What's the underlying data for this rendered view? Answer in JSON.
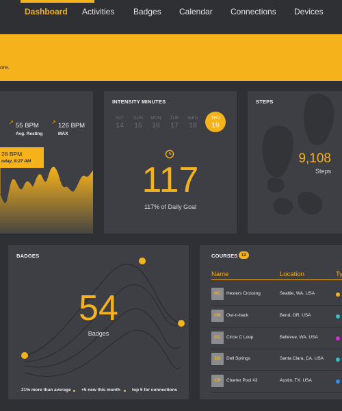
{
  "nav": {
    "items": [
      {
        "label": "Dashboard"
      },
      {
        "label": "Activities"
      },
      {
        "label": "Badges"
      },
      {
        "label": "Calendar"
      },
      {
        "label": "Connections"
      },
      {
        "label": "Devices"
      }
    ]
  },
  "banner": {
    "text": "ore."
  },
  "heart": {
    "resting_value": "55 BPM",
    "resting_label": "Avg. Resting",
    "max_value": "126 BPM",
    "max_label": "MAX",
    "tooltip_value": "28 BPM",
    "tooltip_time": "oday, 8:27 AM"
  },
  "intensity": {
    "title": "INTENSITY MINUTES",
    "days": [
      {
        "name": "SAT",
        "date": "14"
      },
      {
        "name": "SUN",
        "date": "15"
      },
      {
        "name": "MON",
        "date": "16"
      },
      {
        "name": "TUE",
        "date": "17"
      },
      {
        "name": "WED",
        "date": "18"
      },
      {
        "name": "THU",
        "date": "19"
      }
    ],
    "value": "117",
    "goal_text": "117% of Daily Goal"
  },
  "steps": {
    "title": "STEPS",
    "value": "9,108",
    "label": "Steps"
  },
  "badges": {
    "title": "BADGES",
    "value": "54",
    "label": "Badges",
    "footer": [
      "21% more than average",
      "+5 new this month",
      "top 5 for connections"
    ]
  },
  "courses": {
    "title": "COURSES",
    "count": "12",
    "columns": {
      "name": "Name",
      "location": "Location",
      "type": "Ty"
    },
    "rows": [
      {
        "code": "HC",
        "name": "Hesters Crossing",
        "location": "Seattle, WA. USA",
        "type_color": "#f6b21b"
      },
      {
        "code": "OB",
        "name": "Out-n-back",
        "location": "Bend, OR. USA",
        "type_color": "#2ec4c4"
      },
      {
        "code": "CC",
        "name": "Circle C Loop",
        "location": "Bellevue, WA. USA",
        "type_color": "#d62bd6"
      },
      {
        "code": "DS",
        "name": "Dell Springs",
        "location": "Santa Clara, CA. USA",
        "type_color": "#2ec4c4"
      },
      {
        "code": "CP",
        "name": "Charter Pool #3",
        "location": "Austin, TX. USA",
        "type_color": "#2b8ff0"
      }
    ]
  },
  "colors": {
    "accent": "#f6b21b",
    "card": "#3d3f44",
    "background": "#2e3034"
  }
}
